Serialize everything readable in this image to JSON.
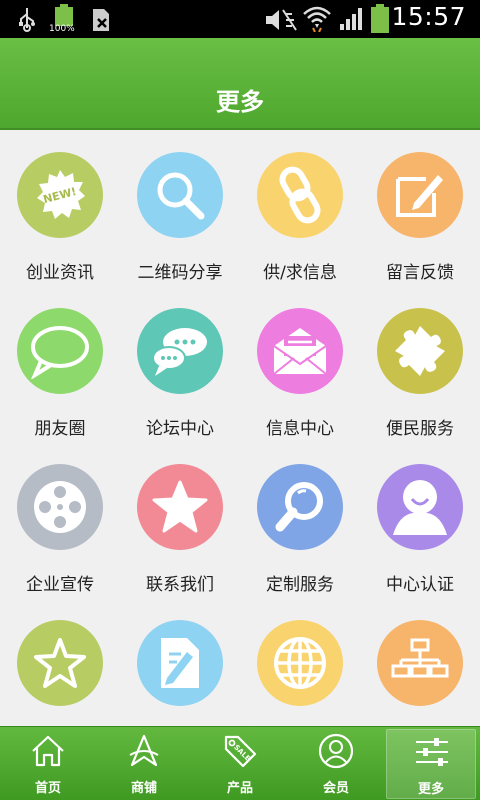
{
  "status_bar": {
    "time": "15:57",
    "battery_percent_label": "100%",
    "icons": [
      "usb-icon",
      "battery-icon",
      "sim-icon",
      "mute-icon",
      "wifi-icon",
      "signal-icon",
      "battery-icon"
    ]
  },
  "header": {
    "title": "更多"
  },
  "grid": {
    "items": [
      {
        "label": "创业资讯",
        "icon": "new-badge-icon",
        "color": "#b7cc62"
      },
      {
        "label": "二维码分享",
        "icon": "search-icon",
        "color": "#8fd3f2"
      },
      {
        "label": "供/求信息",
        "icon": "link-icon",
        "color": "#f9d36e"
      },
      {
        "label": "留言反馈",
        "icon": "edit-icon",
        "color": "#f7b46b"
      },
      {
        "label": "朋友圈",
        "icon": "speech-bubble-icon",
        "color": "#8ed96b"
      },
      {
        "label": "论坛中心",
        "icon": "chat-bubbles-icon",
        "color": "#5fc7b6"
      },
      {
        "label": "信息中心",
        "icon": "mail-icon",
        "color": "#ee7de0"
      },
      {
        "label": "便民服务",
        "icon": "puzzle-icon",
        "color": "#c8c24c"
      },
      {
        "label": "企业宣传",
        "icon": "film-reel-icon",
        "color": "#b5bcc6"
      },
      {
        "label": "联系我们",
        "icon": "star-icon",
        "color": "#f18a95"
      },
      {
        "label": "定制服务",
        "icon": "magnifier-icon",
        "color": "#7fa5e6"
      },
      {
        "label": "中心认证",
        "icon": "user-icon",
        "color": "#a98ae8"
      },
      {
        "label": "",
        "icon": "star-outline-icon",
        "color": "#b7cc62"
      },
      {
        "label": "",
        "icon": "document-edit-icon",
        "color": "#8fd3f2"
      },
      {
        "label": "",
        "icon": "globe-icon",
        "color": "#f9d36e"
      },
      {
        "label": "",
        "icon": "sitemap-icon",
        "color": "#f7b46b"
      }
    ]
  },
  "bottom_nav": {
    "items": [
      {
        "label": "首页",
        "icon": "home-icon"
      },
      {
        "label": "商铺",
        "icon": "shop-icon"
      },
      {
        "label": "产品",
        "icon": "sale-tag-icon"
      },
      {
        "label": "会员",
        "icon": "member-icon"
      },
      {
        "label": "更多",
        "icon": "settings-sliders-icon",
        "active": true
      }
    ]
  }
}
